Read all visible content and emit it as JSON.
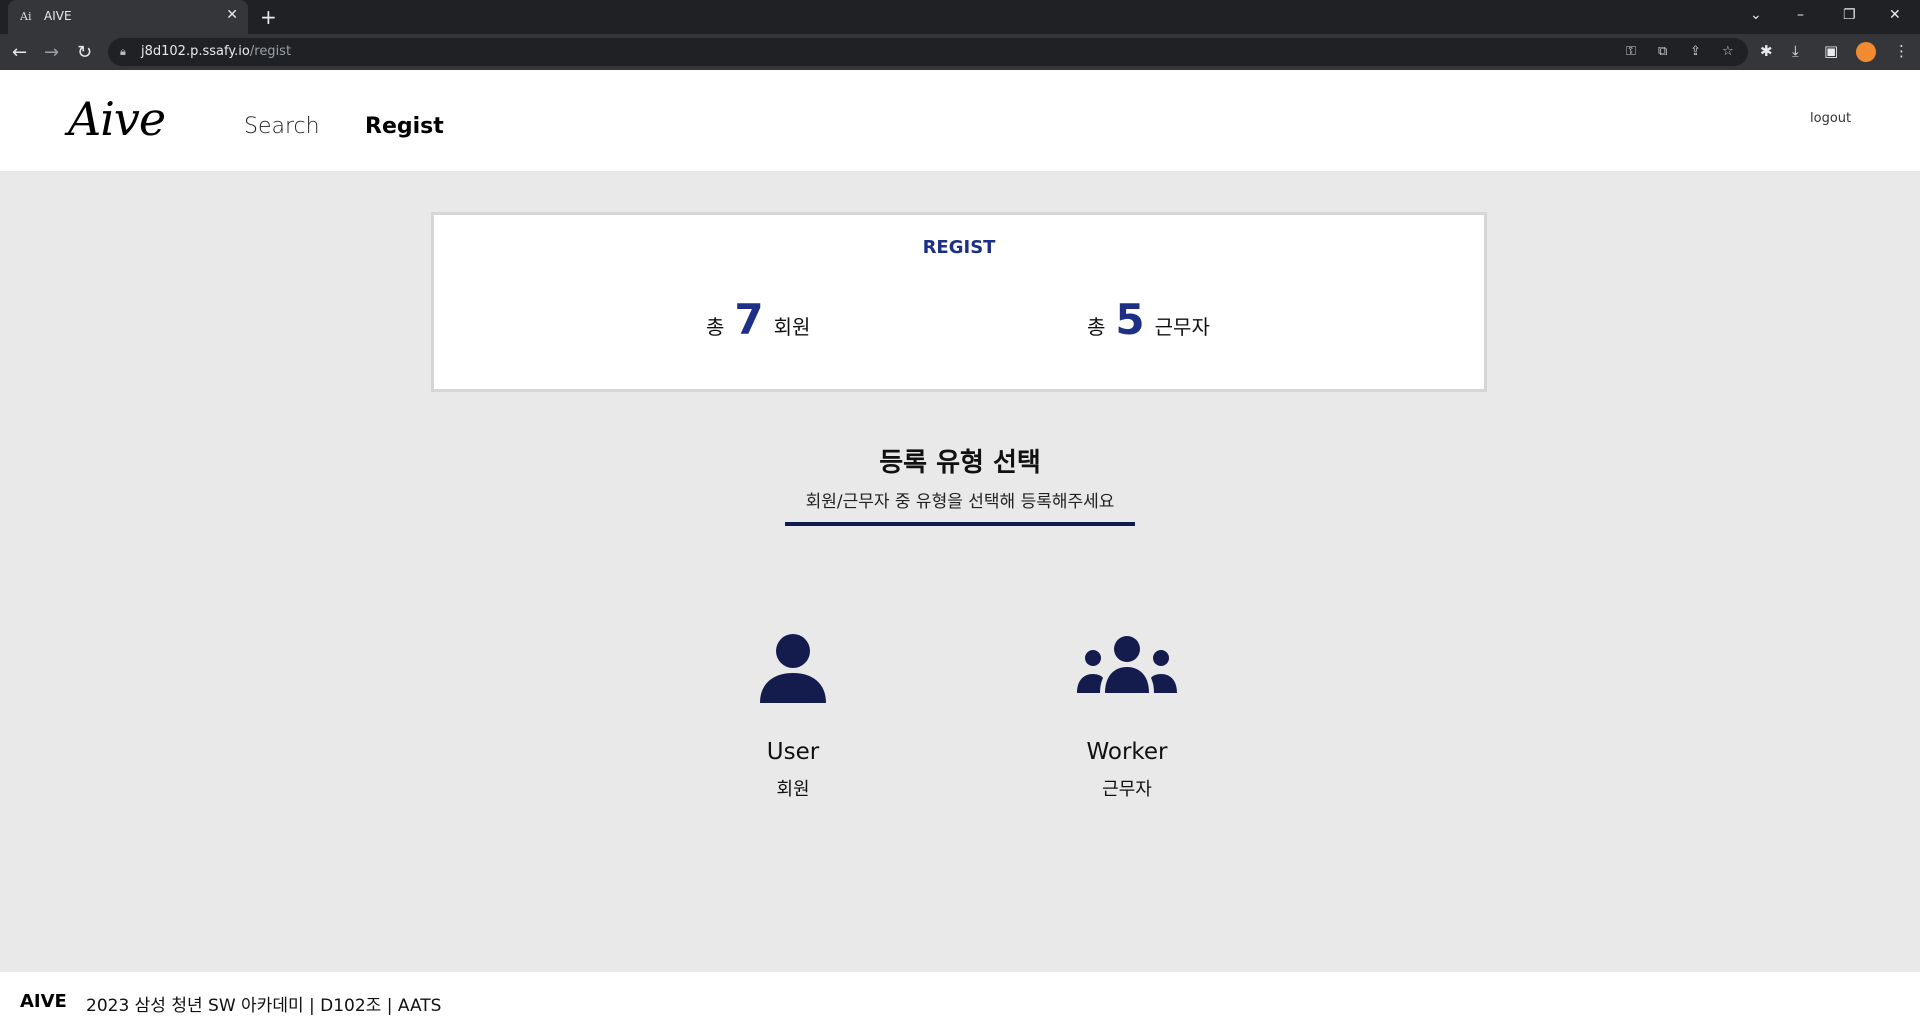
{
  "browser": {
    "tab_title": "AIVE",
    "tab_favicon": "Ai",
    "url_host": "j8d102.p.ssafy.io",
    "url_path": "/regist"
  },
  "header": {
    "logo": "Aive",
    "nav": {
      "search": "Search",
      "regist": "Regist"
    },
    "logout": "logout"
  },
  "stats_card": {
    "title": "REGIST",
    "members": {
      "prefix": "총",
      "count": "7",
      "suffix": "회원"
    },
    "workers": {
      "prefix": "총",
      "count": "5",
      "suffix": "근무자"
    }
  },
  "selection": {
    "title": "등록 유형 선택",
    "subtitle": "회원/근무자 중 유형을 선택해 등록해주세요",
    "options": [
      {
        "icon": "user-icon",
        "label_en": "User",
        "label_ko": "회원"
      },
      {
        "icon": "users-group-icon",
        "label_en": "Worker",
        "label_ko": "근무자"
      }
    ]
  },
  "footer": {
    "brand": "AIVE",
    "copyright": "2023 삼성 청년 SW 아카데미 | D102조 | AATS"
  },
  "colors": {
    "accent": "#1e3085",
    "icon": "#141b4d",
    "background": "#e9e9ea"
  }
}
